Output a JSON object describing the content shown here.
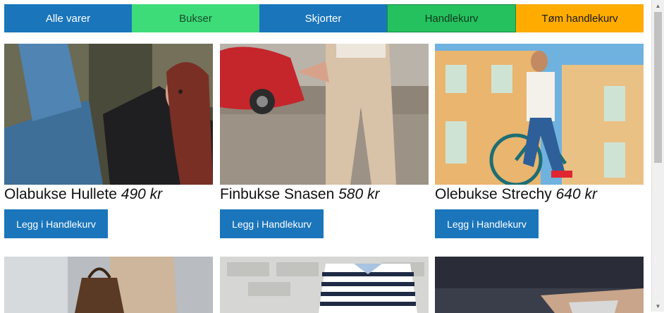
{
  "nav": {
    "all": "Alle varer",
    "pants": "Bukser",
    "shirts": "Skjorter",
    "cart": "Handlekurv",
    "empty_cart": "Tøm handlekurv"
  },
  "products": [
    {
      "name": "Olabukse Hullete",
      "price": "490 kr",
      "button": "Legg i Handlekurv"
    },
    {
      "name": "Finbukse Snasen",
      "price": "580 kr",
      "button": "Legg i Handlekurv"
    },
    {
      "name": "Olebukse Strechy",
      "price": "640 kr",
      "button": "Legg i Handlekurv"
    }
  ],
  "colors": {
    "primary": "#1a75bb",
    "green_light": "#3ddc78",
    "green": "#25c15e",
    "orange": "#ffab00"
  }
}
